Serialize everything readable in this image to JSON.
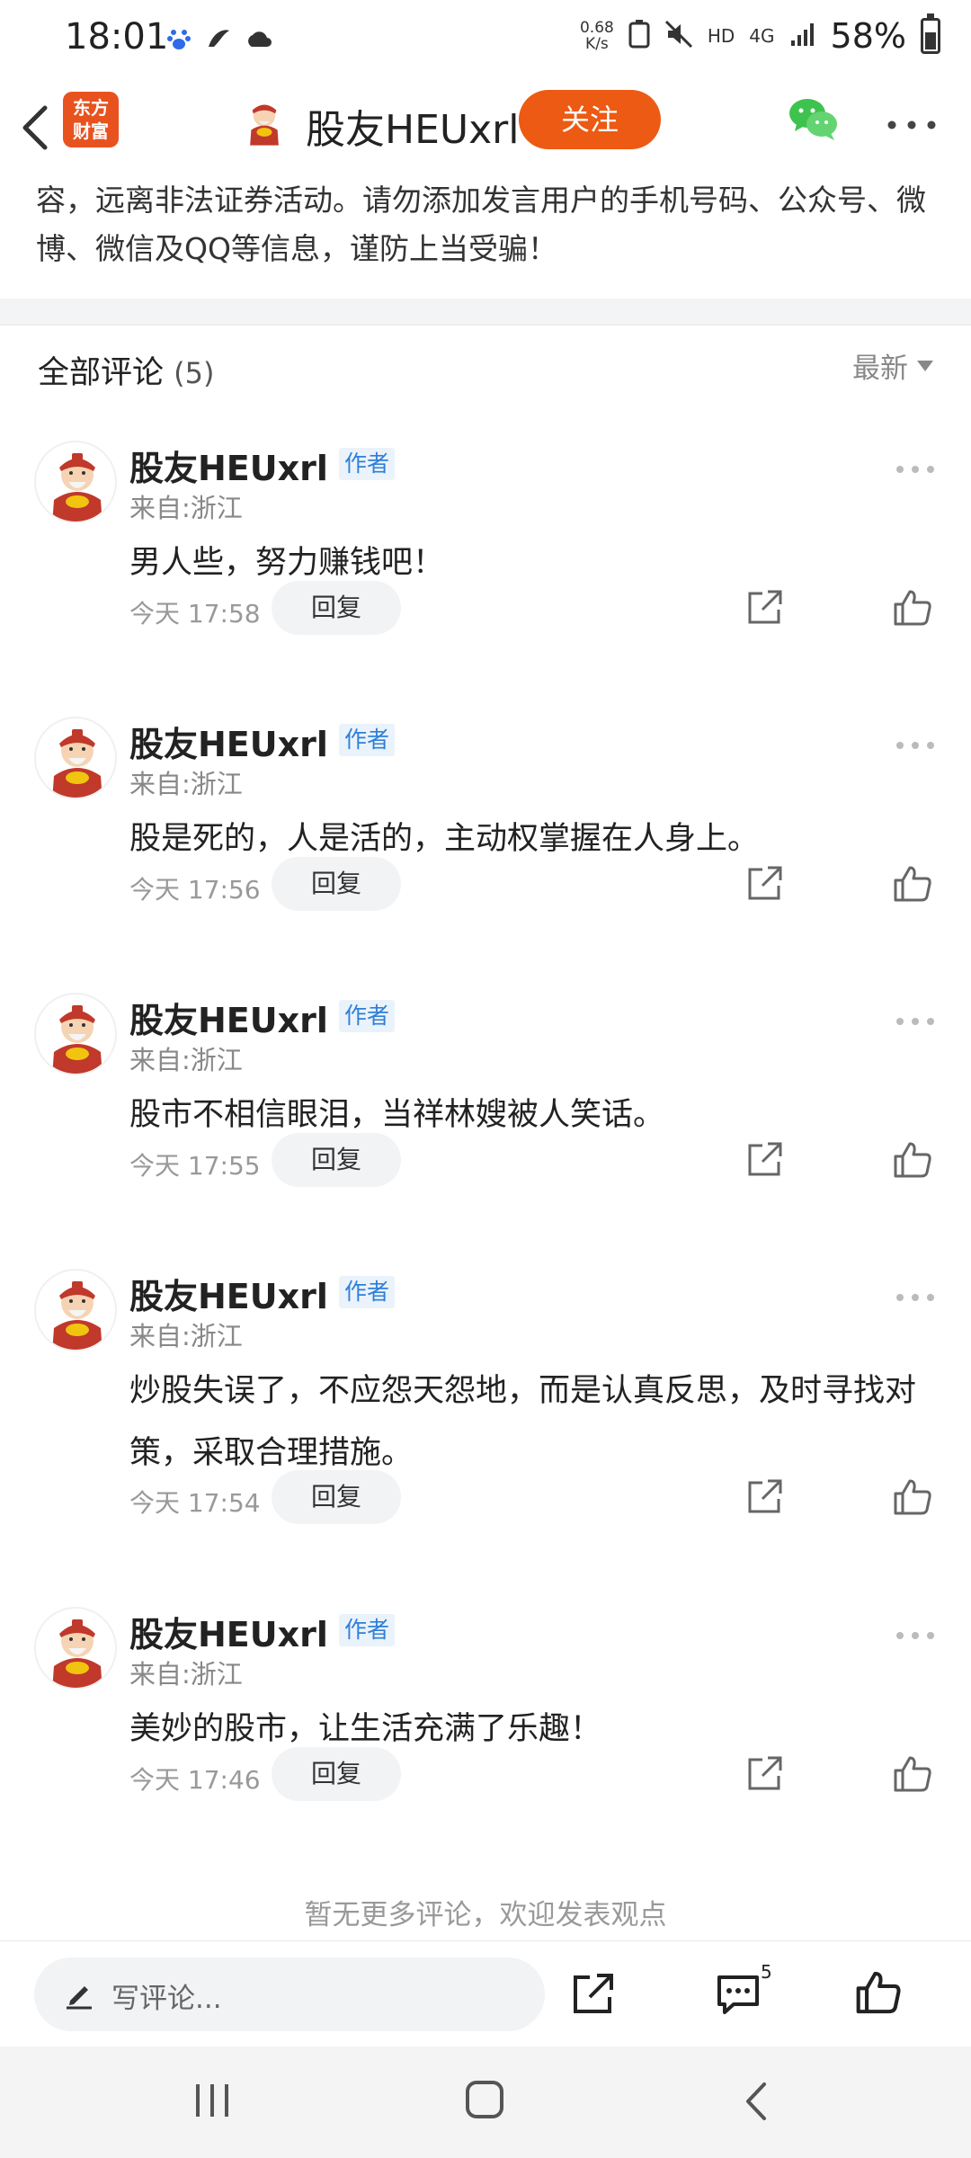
{
  "status_bar": {
    "time": "18:01",
    "net_speed_value": "0.68",
    "net_speed_unit": "K/s",
    "hd": "HD",
    "network": "4G",
    "battery": "58%",
    "icons": [
      "baidu-icon",
      "bird-icon",
      "cloud-icon",
      "recycle-icon",
      "mute-icon",
      "signal-icon",
      "battery-icon"
    ]
  },
  "header": {
    "app_logo_line1": "东方",
    "app_logo_line2": "财富",
    "title": "股友HEUxrl",
    "follow_label": "关注",
    "accent_color": "#ec5a13"
  },
  "disclaimer": "容，远离非法证券活动。请勿添加发言用户的手机号码、公众号、微博、微信及QQ等信息，谨防上当受骗！",
  "comments_section": {
    "title": "全部评论",
    "count": "(5)",
    "sort_label": "最新"
  },
  "comments": [
    {
      "author": "股友HEUxrl",
      "badge": "作者",
      "location": "来自:浙江",
      "text": "男人些，努力赚钱吧！",
      "time": "今天 17:58",
      "reply_label": "回复"
    },
    {
      "author": "股友HEUxrl",
      "badge": "作者",
      "location": "来自:浙江",
      "text": "股是死的，人是活的，主动权掌握在人身上。",
      "time": "今天 17:56",
      "reply_label": "回复"
    },
    {
      "author": "股友HEUxrl",
      "badge": "作者",
      "location": "来自:浙江",
      "text": "股市不相信眼泪，当祥林嫂被人笑话。",
      "time": "今天 17:55",
      "reply_label": "回复"
    },
    {
      "author": "股友HEUxrl",
      "badge": "作者",
      "location": "来自:浙江",
      "text": "炒股失误了，不应怨天怨地，而是认真反思，及时寻找对策，采取合理措施。",
      "time": "今天 17:54",
      "reply_label": "回复"
    },
    {
      "author": "股友HEUxrl",
      "badge": "作者",
      "location": "来自:浙江",
      "text": "美妙的股市，让生活充满了乐趣！",
      "time": "今天 17:46",
      "reply_label": "回复"
    }
  ],
  "no_more_text": "暂无更多评论，欢迎发表观点",
  "bottom_bar": {
    "write_placeholder": "写评论...",
    "comment_count": "5"
  }
}
